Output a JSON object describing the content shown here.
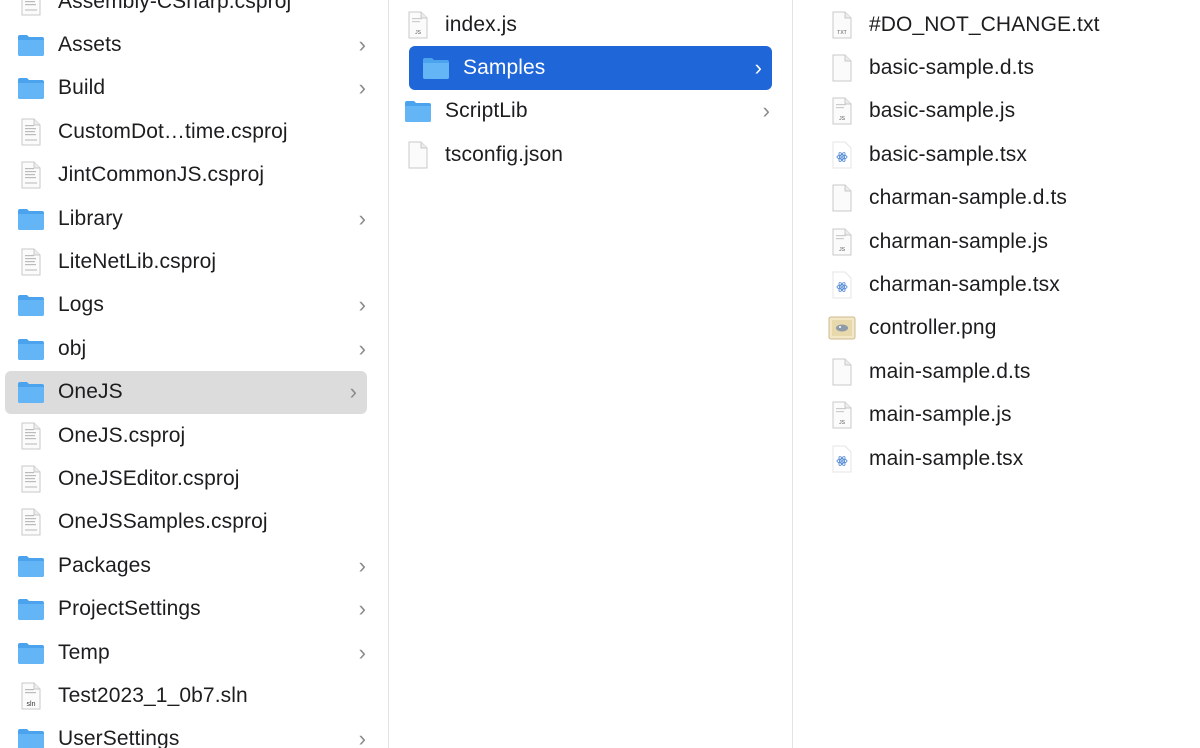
{
  "columns": [
    {
      "name": "project-root",
      "items": [
        {
          "label": "Assembly-CSharp.csproj",
          "type": "doc"
        },
        {
          "label": "Assets",
          "type": "folder",
          "chevron": true
        },
        {
          "label": "Build",
          "type": "folder",
          "chevron": true
        },
        {
          "label": "CustomDot…time.csproj",
          "type": "doc"
        },
        {
          "label": "JintCommonJS.csproj",
          "type": "doc"
        },
        {
          "label": "Library",
          "type": "folder",
          "chevron": true
        },
        {
          "label": "LiteNetLib.csproj",
          "type": "doc"
        },
        {
          "label": "Logs",
          "type": "folder",
          "chevron": true
        },
        {
          "label": "obj",
          "type": "folder",
          "chevron": true
        },
        {
          "label": "OneJS",
          "type": "folder",
          "chevron": true,
          "selected": "inactive"
        },
        {
          "label": "OneJS.csproj",
          "type": "doc"
        },
        {
          "label": "OneJSEditor.csproj",
          "type": "doc"
        },
        {
          "label": "OneJSSamples.csproj",
          "type": "doc"
        },
        {
          "label": "Packages",
          "type": "folder",
          "chevron": true
        },
        {
          "label": "ProjectSettings",
          "type": "folder",
          "chevron": true
        },
        {
          "label": "Temp",
          "type": "folder",
          "chevron": true
        },
        {
          "label": "Test2023_1_0b7.sln",
          "type": "sln"
        },
        {
          "label": "UserSettings",
          "type": "folder",
          "chevron": true
        }
      ]
    },
    {
      "name": "onejs",
      "items": [
        {
          "label": "index.js",
          "type": "js"
        },
        {
          "label": "Samples",
          "type": "folder",
          "chevron": true,
          "selected": "active"
        },
        {
          "label": "ScriptLib",
          "type": "folder",
          "chevron": true
        },
        {
          "label": "tsconfig.json",
          "type": "blank"
        }
      ]
    },
    {
      "name": "samples",
      "items": [
        {
          "label": "#DO_NOT_CHANGE.txt",
          "type": "txt"
        },
        {
          "label": "basic-sample.d.ts",
          "type": "blank"
        },
        {
          "label": "basic-sample.js",
          "type": "js"
        },
        {
          "label": "basic-sample.tsx",
          "type": "tsx"
        },
        {
          "label": "charman-sample.d.ts",
          "type": "blank"
        },
        {
          "label": "charman-sample.js",
          "type": "js"
        },
        {
          "label": "charman-sample.tsx",
          "type": "tsx"
        },
        {
          "label": "controller.png",
          "type": "png"
        },
        {
          "label": "main-sample.d.ts",
          "type": "blank"
        },
        {
          "label": "main-sample.js",
          "type": "js"
        },
        {
          "label": "main-sample.tsx",
          "type": "tsx"
        }
      ]
    }
  ],
  "chevron_glyph": "›",
  "icon_badges": {
    "js": "JS",
    "txt": "TXT",
    "sln": "sln"
  },
  "colors": {
    "selection_active": "#1f66d8",
    "selection_inactive": "#dcdcdc",
    "folder": "#5aaef5"
  }
}
